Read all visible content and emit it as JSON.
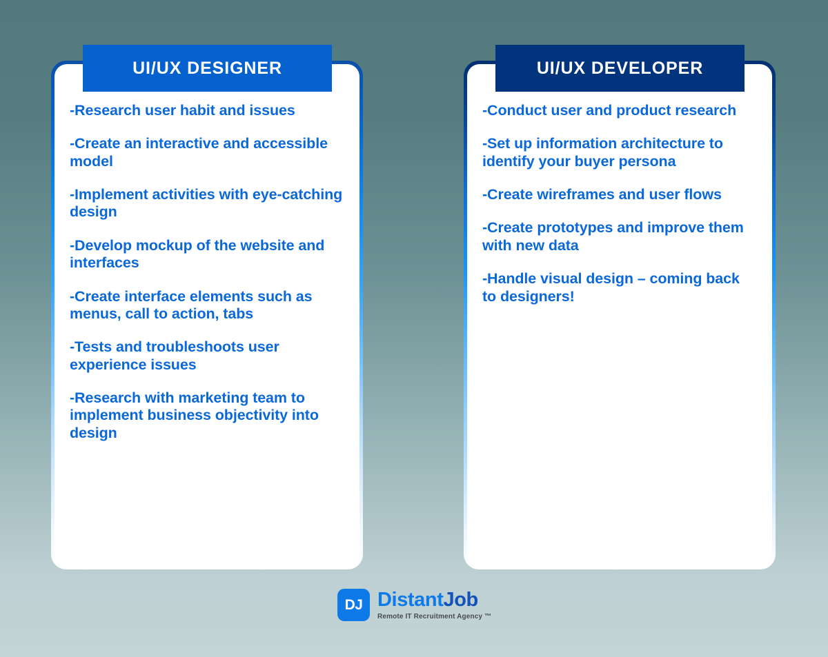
{
  "colors": {
    "background_top": "#52797C",
    "background_bottom": "#C3D4D6",
    "designer_header_bg": "#0561CE",
    "developer_header_bg": "#01347D",
    "body_text_blue": "#0B68D8",
    "logo_blue": "#0D7AE8"
  },
  "cards": [
    {
      "id": "designer",
      "title": "UI/UX DESIGNER",
      "items": [
        "-Research user habit and issues",
        "-Create an interactive and accessible model",
        "-Implement activities with eye-catching design",
        "-Develop mockup of the website and interfaces",
        "-Create interface elements such as menus, call to action, tabs",
        "-Tests and troubleshoots user experience issues",
        "-Research with marketing team to implement business objectivity into design"
      ]
    },
    {
      "id": "developer",
      "title": "UI/UX DEVELOPER",
      "items": [
        "-Conduct user and product research",
        "-Set up information architecture to identify your buyer persona",
        "-Create wireframes and user flows",
        "-Create prototypes and improve them with new data",
        "-Handle visual design – coming back to designers!"
      ]
    }
  ],
  "logo": {
    "mark": "DJ",
    "name_first": "Distant",
    "name_second": "Job",
    "tagline": "Remote IT Recruitment Agency ™"
  }
}
